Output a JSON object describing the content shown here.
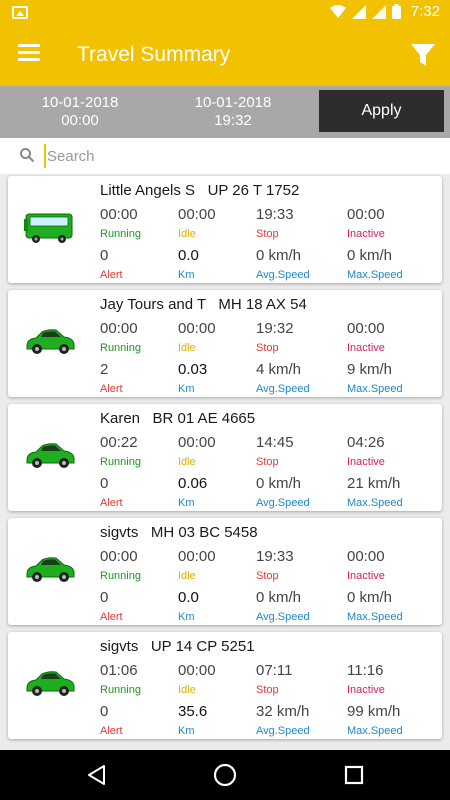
{
  "status_bar": {
    "time": "7:32"
  },
  "app_bar": {
    "title": "Travel Summary"
  },
  "date_range": {
    "from_date": "10-01-2018",
    "from_time": "00:00",
    "to_date": "10-01-2018",
    "to_time": "19:32",
    "apply_label": "Apply"
  },
  "search": {
    "placeholder": "Search",
    "value": ""
  },
  "labels": {
    "running": "Running",
    "idle": "Idle",
    "stop": "Stop",
    "inactive": "Inactive",
    "alert": "Alert",
    "km": "Km",
    "avg_speed": "Avg.Speed",
    "max_speed": "Max.Speed"
  },
  "colors": {
    "accent": "#f2c200",
    "running": "#1a9a1a",
    "idle": "#e0b000",
    "stop": "#e53935",
    "inactive": "#d81b60",
    "alert": "#e53935",
    "km": "#1e88c8",
    "speed": "#1e88c8",
    "vehicle_green": "#1fae1f"
  },
  "vehicles": [
    {
      "name": "Little Angels S   UP 26 T 1752",
      "icon": "bus-icon",
      "running": "00:00",
      "idle": "00:00",
      "stop": "19:33",
      "inactive": "00:00",
      "alert": "0",
      "km": "0.0",
      "avg_speed": "0 km/h",
      "max_speed": "0 km/h"
    },
    {
      "name": "Jay Tours and T   MH 18 AX 54",
      "icon": "car-icon",
      "running": "00:00",
      "idle": "00:00",
      "stop": "19:32",
      "inactive": "00:00",
      "alert": "2",
      "km": "0.03",
      "avg_speed": "4 km/h",
      "max_speed": "9 km/h"
    },
    {
      "name": "Karen   BR 01 AE 4665",
      "icon": "car-icon",
      "running": "00:22",
      "idle": "00:00",
      "stop": "14:45",
      "inactive": "04:26",
      "alert": "0",
      "km": "0.06",
      "avg_speed": "0 km/h",
      "max_speed": "21 km/h"
    },
    {
      "name": "sigvts   MH 03 BC 5458",
      "icon": "car-icon",
      "running": "00:00",
      "idle": "00:00",
      "stop": "19:33",
      "inactive": "00:00",
      "alert": "0",
      "km": "0.0",
      "avg_speed": "0 km/h",
      "max_speed": "0 km/h"
    },
    {
      "name": "sigvts   UP 14 CP 5251",
      "icon": "car-icon",
      "running": "01:06",
      "idle": "00:00",
      "stop": "07:11",
      "inactive": "11:16",
      "alert": "0",
      "km": "35.6",
      "avg_speed": "32 km/h",
      "max_speed": "99 km/h"
    }
  ]
}
